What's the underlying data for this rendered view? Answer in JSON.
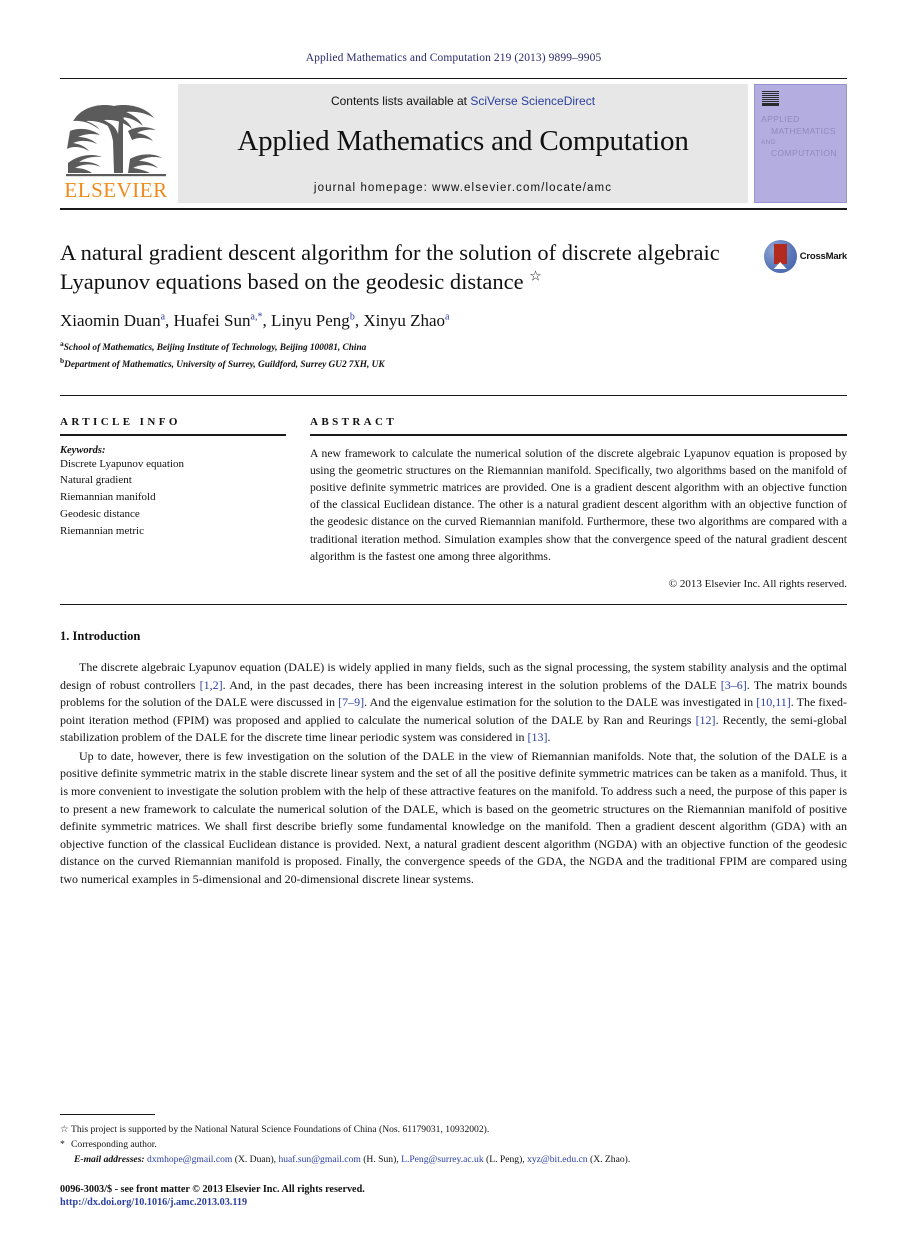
{
  "running_head": "Applied Mathematics and Computation 219 (2013) 9899–9905",
  "masthead": {
    "publisher_logo_text": "ELSEVIER",
    "contents_prefix": "Contents lists available at ",
    "contents_link": "SciVerse ScienceDirect",
    "journal_title": "Applied Mathematics and Computation",
    "homepage": "journal homepage: www.elsevier.com/locate/amc",
    "cover": {
      "line1": "APPLIED",
      "line2": "MATHEMATICS",
      "line3": "AND",
      "line4": "COMPUTATION"
    }
  },
  "article": {
    "title": "A natural gradient descent algorithm for the solution of discrete algebraic Lyapunov equations based on the geodesic distance",
    "title_footnote_mark": "☆",
    "crossmark_label": "CrossMark",
    "authors": [
      {
        "name": "Xiaomin Duan",
        "sup": "a"
      },
      {
        "name": "Huafei Sun",
        "sup": "a,*"
      },
      {
        "name": "Linyu Peng",
        "sup": "b"
      },
      {
        "name": "Xinyu Zhao",
        "sup": "a"
      }
    ],
    "affiliations": [
      {
        "mark": "a",
        "text": "School of Mathematics, Beijing Institute of Technology, Beijing 100081, China"
      },
      {
        "mark": "b",
        "text": "Department of Mathematics, University of Surrey, Guildford, Surrey GU2 7XH, UK"
      }
    ]
  },
  "article_info": {
    "heading": "ARTICLE INFO",
    "keywords_label": "Keywords:",
    "keywords": [
      "Discrete Lyapunov equation",
      "Natural gradient",
      "Riemannian manifold",
      "Geodesic distance",
      "Riemannian metric"
    ]
  },
  "abstract": {
    "heading": "ABSTRACT",
    "text": "A new framework to calculate the numerical solution of the discrete algebraic Lyapunov equation is proposed by using the geometric structures on the Riemannian manifold. Specifically, two algorithms based on the manifold of positive definite symmetric matrices are provided. One is a gradient descent algorithm with an objective function of the classical Euclidean distance. The other is a natural gradient descent algorithm with an objective function of the geodesic distance on the curved Riemannian manifold. Furthermore, these two algorithms are compared with a traditional iteration method. Simulation examples show that the convergence speed of the natural gradient descent algorithm is the fastest one among three algorithms.",
    "copyright": "© 2013 Elsevier Inc. All rights reserved."
  },
  "introduction": {
    "section_number_title": "1. Introduction",
    "paragraph1_part1": "The discrete algebraic Lyapunov equation (DALE) is widely applied in many fields, such as the signal processing, the system stability analysis and the optimal design of robust controllers ",
    "ref_12": "[1,2]",
    "paragraph1_part2": ". And, in the past decades, there has been increasing interest in the solution problems of the DALE ",
    "ref_36": "[3–6]",
    "paragraph1_part3": ". The matrix bounds problems for the solution of the DALE were discussed in ",
    "ref_79": "[7–9]",
    "paragraph1_part4": ". And the eigenvalue estimation for the solution to the DALE was investigated in ",
    "ref_1011": "[10,11]",
    "paragraph1_part5": ". The fixed-point iteration method (FPIM) was proposed and applied to calculate the numerical solution of the DALE by Ran and Reurings ",
    "ref_12b": "[12]",
    "paragraph1_part6": ". Recently, the semi-global stabilization problem of the DALE for the discrete time linear periodic system was considered in ",
    "ref_13": "[13]",
    "paragraph1_part7": ".",
    "paragraph2": "Up to date, however, there is few investigation on the solution of the DALE in the view of Riemannian manifolds. Note that, the solution of the DALE is a positive definite symmetric matrix in the stable discrete linear system and the set of all the positive definite symmetric matrices can be taken as a manifold. Thus, it is more convenient to investigate the solution problem with the help of these attractive features on the manifold. To address such a need, the purpose of this paper is to present a new framework to calculate the numerical solution of the DALE, which is based on the geometric structures on the Riemannian manifold of positive definite symmetric matrices. We shall first describe briefly some fundamental knowledge on the manifold. Then a gradient descent algorithm (GDA) with an objective function of the classical Euclidean distance is provided. Next, a natural gradient descent algorithm (NGDA) with an objective function of the geodesic distance on the curved Riemannian manifold is proposed. Finally, the convergence speeds of the GDA, the NGDA and the traditional FPIM are compared using two numerical examples in 5-dimensional and 20-dimensional discrete linear systems."
  },
  "footnotes": {
    "funding_mark": "☆",
    "funding": "This project is supported by the National Natural Science Foundations of China (Nos. 61179031, 10932002).",
    "corresponding_mark": "*",
    "corresponding": "Corresponding author.",
    "email_label": "E-mail addresses:",
    "emails": [
      {
        "address": "dxmhope@gmail.com",
        "person": "(X. Duan)"
      },
      {
        "address": "huaf.sun@gmail.com",
        "person": "(H. Sun)"
      },
      {
        "address": "L.Peng@surrey.ac.uk",
        "person": "(L. Peng)"
      },
      {
        "address": "xyz@bit.edu.cn",
        "person": "(X. Zhao)"
      }
    ],
    "issn_line": "0096-3003/$ - see front matter © 2013 Elsevier Inc. All rights reserved.",
    "doi": "http://dx.doi.org/10.1016/j.amc.2013.03.119"
  },
  "colors": {
    "link_blue": "#2b3fa0",
    "elsevier_orange": "#f08a1c",
    "band_gray": "#e7e7e7",
    "cover_purple": "#b3ade0"
  }
}
